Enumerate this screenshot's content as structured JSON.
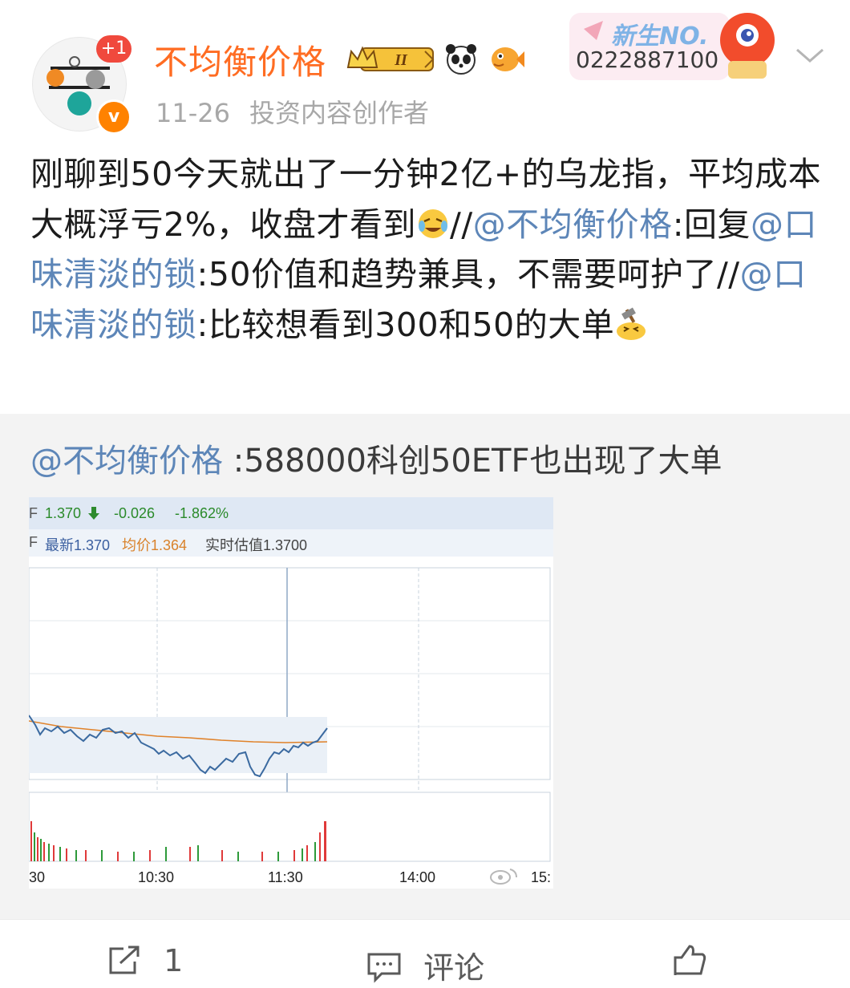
{
  "post": {
    "username": "不均衡价格",
    "avatar_badge": "+1",
    "verified_mark": "v",
    "level_badge": "II",
    "date": "11-26",
    "role": "投资内容创作者",
    "promo": {
      "title": "新生NO.",
      "number": "0222887100"
    },
    "content": {
      "p1": "刚聊到50今天就出了一分钟2亿+的乌龙指，平均成本大概浮亏2%，收盘才看到",
      "p2": "//",
      "m1": "@不均衡价格",
      "p3": ":回复",
      "m2": "@口味清淡的锁",
      "p4": ":50价值和趋势兼具，不需要呵护了//",
      "m3": "@口味清淡的锁",
      "p5": ":比较想看到300和50的大单"
    }
  },
  "repost": {
    "mention": "@不均衡价格",
    "text": " :588000科创50ETF也出现了大单"
  },
  "stock": {
    "r1_prefix": "F",
    "price": "1.370",
    "change": "-0.026",
    "change_pct": "-1.862%",
    "r2_prefix": "F",
    "latest": "最新1.370",
    "avg": "均价1.364",
    "est": "实时估值1.3700",
    "times": [
      "30",
      "10:30",
      "11:30",
      "14:00",
      "15:"
    ],
    "colors": {
      "up": "#e03a3a",
      "down": "#2e9a3a",
      "price_line": "#3b6aa0",
      "avg_line": "#e0822a"
    }
  },
  "actions": {
    "share_count": "1",
    "comment_label": "评论"
  }
}
